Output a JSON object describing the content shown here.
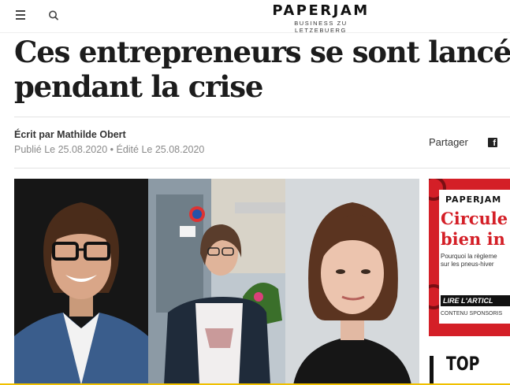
{
  "header": {
    "menu_icon": "hamburger-menu-icon",
    "search_icon": "search-icon",
    "logo": "PAPERJAM",
    "logo_tagline": "BUSINESS ZU LETZEBUERG"
  },
  "article": {
    "title_line1": "Ces entrepreneurs se sont lancés",
    "title_line2": "pendant la crise",
    "author": "Écrit par Mathilde Obert",
    "dates": "Publié Le 25.08.2020 • Édité Le 25.08.2020",
    "share_label": "Partager",
    "share_icon": "facebook-icon"
  },
  "ad": {
    "logo": "PAPERJAM",
    "title_line1": "Circule",
    "title_line2": "bien in",
    "text_line1": "Pourquoi la règleme",
    "text_line2": "sur les pneus-hiver",
    "cta": "LIRE L'ARTICL",
    "sponsored": "CONTENU SPONSORIS",
    "accent": "#d41f27"
  },
  "sidebar": {
    "top_label": "TOP"
  },
  "colors": {
    "bottom_line": "#f0c000"
  }
}
